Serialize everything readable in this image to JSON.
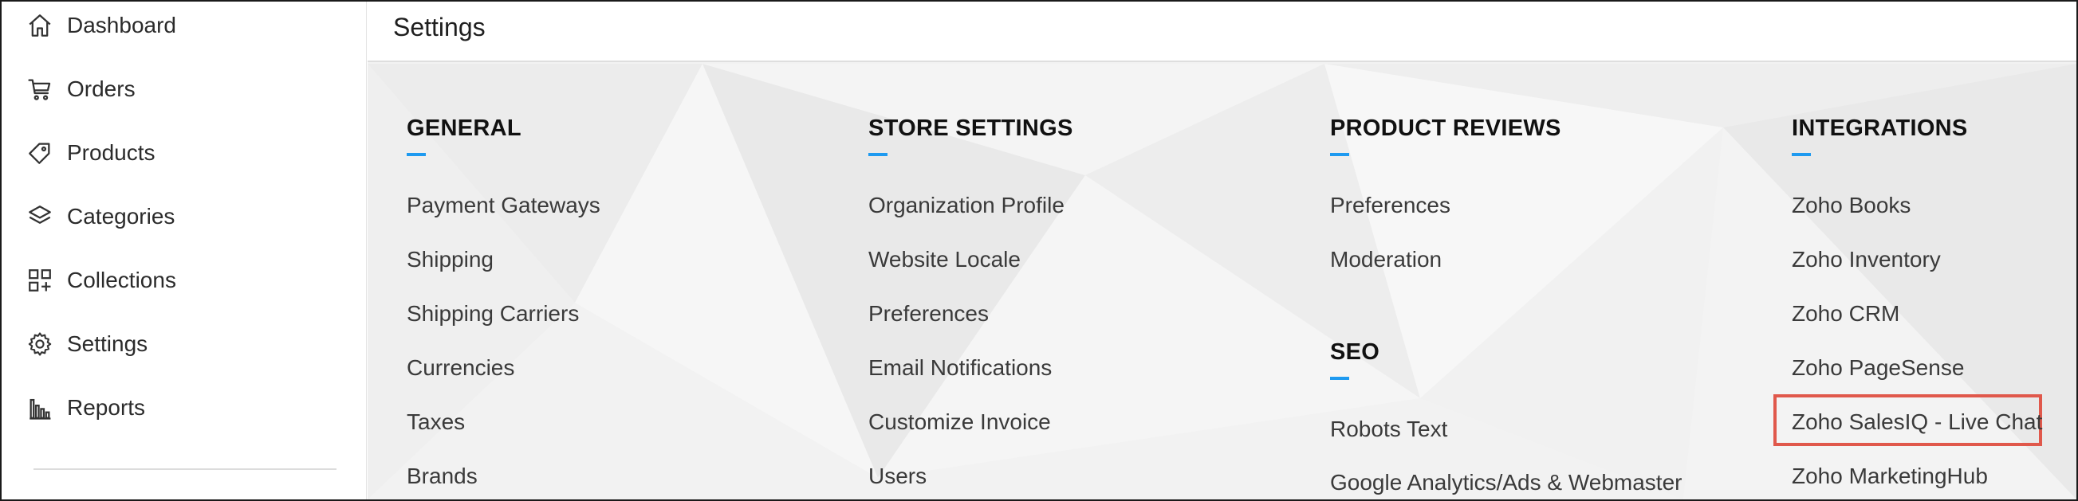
{
  "sidebar": {
    "items": [
      {
        "label": "Dashboard",
        "icon": "home-icon"
      },
      {
        "label": "Orders",
        "icon": "cart-icon"
      },
      {
        "label": "Products",
        "icon": "tag-icon"
      },
      {
        "label": "Categories",
        "icon": "layers-icon"
      },
      {
        "label": "Collections",
        "icon": "collections-icon"
      },
      {
        "label": "Settings",
        "icon": "gear-icon"
      },
      {
        "label": "Reports",
        "icon": "bar-chart-icon"
      }
    ]
  },
  "header": {
    "title": "Settings"
  },
  "sections": {
    "general": {
      "title": "GENERAL",
      "links": [
        "Payment Gateways",
        "Shipping",
        "Shipping Carriers",
        "Currencies",
        "Taxes",
        "Brands"
      ]
    },
    "store_settings": {
      "title": "STORE SETTINGS",
      "links": [
        "Organization Profile",
        "Website Locale",
        "Preferences",
        "Email Notifications",
        "Customize Invoice",
        "Users"
      ]
    },
    "product_reviews": {
      "title": "PRODUCT REVIEWS",
      "links": [
        "Preferences",
        "Moderation"
      ]
    },
    "seo": {
      "title": "SEO",
      "links": [
        "Robots Text",
        "Google Analytics/Ads & Webmaster"
      ]
    },
    "integrations": {
      "title": "INTEGRATIONS",
      "links": [
        "Zoho Books",
        "Zoho Inventory",
        "Zoho CRM",
        "Zoho PageSense",
        "Zoho SalesIQ - Live Chat",
        "Zoho MarketingHub"
      ]
    }
  },
  "colors": {
    "accent_underline": "#1e9af0",
    "highlight_border": "#e0584b"
  }
}
